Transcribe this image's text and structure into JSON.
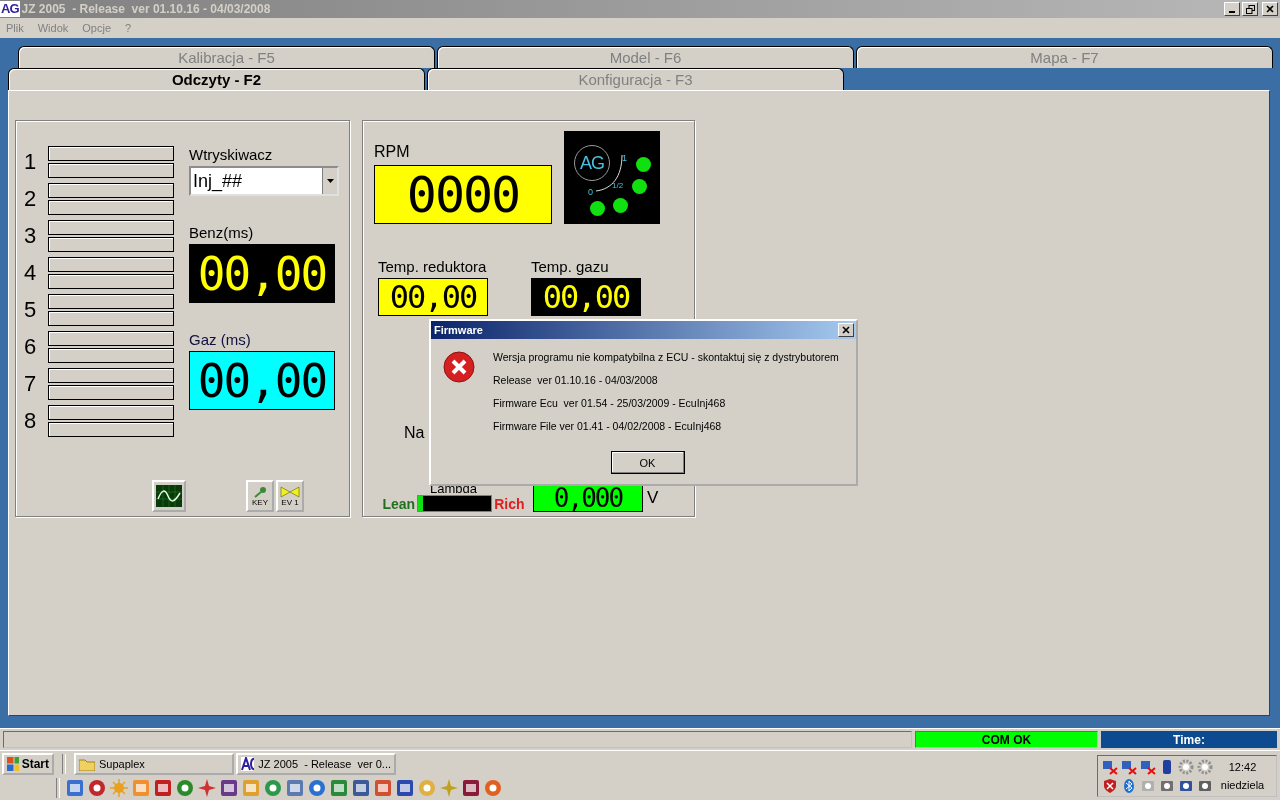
{
  "window": {
    "title": "JZ 2005  - Release  ver 01.10.16 - 04/03/2008",
    "logo": "AG"
  },
  "menu": [
    "Plik",
    "Widok",
    "Opcje",
    "?"
  ],
  "tab_rows": [
    {
      "tabs": [
        {
          "label": "Kalibracja - F5",
          "selected": false
        },
        {
          "label": "Model - F6",
          "selected": false
        },
        {
          "label": "Mapa - F7",
          "selected": false
        }
      ]
    },
    {
      "tabs": [
        {
          "label": "Odczyty - F2",
          "selected": true
        },
        {
          "label": "Konfiguracja - F3",
          "selected": false
        }
      ]
    }
  ],
  "injectors": [
    {
      "label": "1"
    },
    {
      "label": "2"
    },
    {
      "label": "3"
    },
    {
      "label": "4"
    },
    {
      "label": "5"
    },
    {
      "label": "6"
    },
    {
      "label": "7"
    },
    {
      "label": "8"
    }
  ],
  "injector_select": {
    "label": "Wtryskiwacz",
    "value": "Inj_##"
  },
  "benz": {
    "label": "Benz(ms)",
    "value": "00,00"
  },
  "gaz": {
    "label": "Gaz (ms)",
    "value": "00,00"
  },
  "tool_buttons": [
    {
      "kind": "scope"
    },
    {
      "kind": "key",
      "label": "KEY"
    },
    {
      "kind": "valve",
      "label": "EV 1"
    }
  ],
  "rpm": {
    "label": "RPM",
    "value": "0000"
  },
  "gauge": {
    "logo": "AG",
    "marks": [
      "1",
      "1/2",
      "0"
    ]
  },
  "temp_reducer": {
    "label": "Temp. reduktora",
    "value": "00,00"
  },
  "temp_gas": {
    "label": "Temp. gazu",
    "value": "00,00"
  },
  "covered_label": "Na",
  "lambda": {
    "label": "Lambda",
    "lean": "Lean",
    "rich": "Rich",
    "level": 0.06,
    "value": "0,000",
    "unit": "V"
  },
  "dialog": {
    "title": "Firmware",
    "lines": [
      "Wersja programu nie kompatybilna z ECU - skontaktuj się z dystrybutorem",
      "Release  ver 01.10.16 - 04/03/2008",
      "Firmware Ecu  ver 01.54 - 25/03/2009 - EcuInj468",
      "Firmware File ver 01.41 - 04/02/2008 - EcuInj468"
    ],
    "button": "OK"
  },
  "status_bar": {
    "com": "COM OK",
    "time": "Time:"
  },
  "taskbar": {
    "start": "Start",
    "tasks": [
      {
        "label": "Supaplex",
        "kind": "folder"
      },
      {
        "label": "JZ 2005  - Release  ver 0...",
        "kind": "app"
      }
    ],
    "clock": "12:42",
    "day": "niedziela"
  }
}
